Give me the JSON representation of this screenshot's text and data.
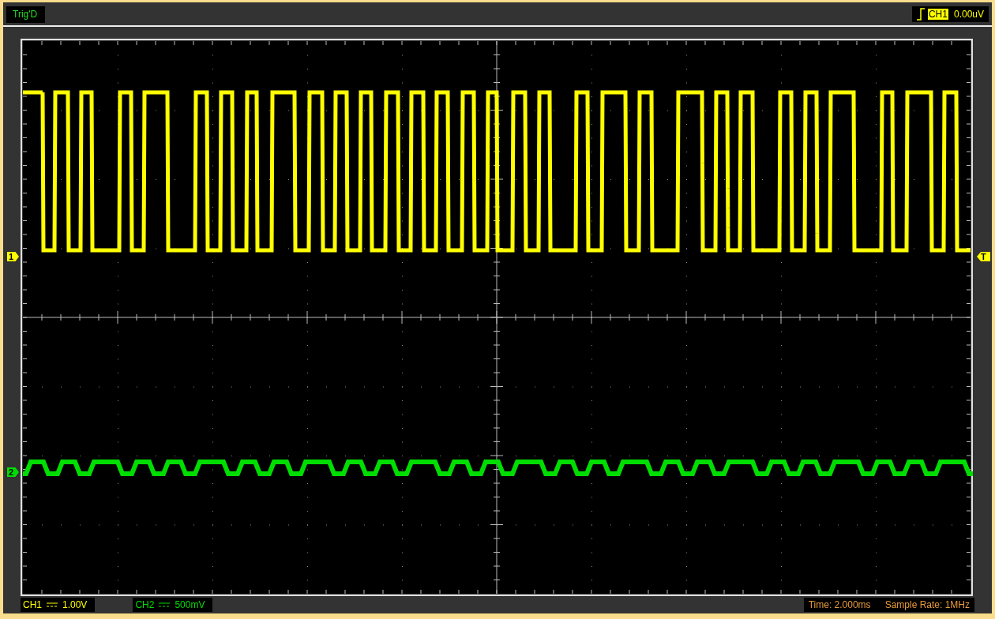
{
  "trigger_status": "Trig'D",
  "trigger": {
    "channel": "CH1",
    "level": "0.00uV",
    "marker": "T"
  },
  "channels": [
    {
      "name": "CH1",
      "scale": "1.00V",
      "marker": "1",
      "color": "#ffff00"
    },
    {
      "name": "CH2",
      "scale": "500mV",
      "marker": "2",
      "color": "#00dd00"
    }
  ],
  "time": "Time: 2.000ms",
  "sample_rate": "Sample Rate: 1MHz"
}
